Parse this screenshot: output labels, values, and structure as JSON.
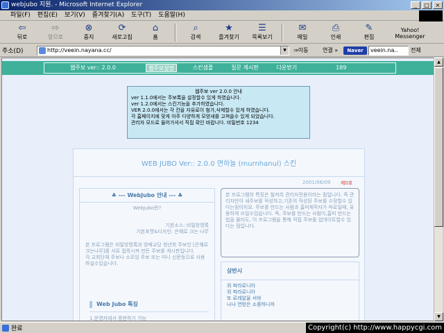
{
  "window": {
    "title": "webjubo 지원. - Microsoft Internet Explorer",
    "buttons": [
      "_",
      "□",
      "×"
    ]
  },
  "menu": [
    "파일(F)",
    "편집(E)",
    "보기(V)",
    "즐겨찾기(A)",
    "도구(T)",
    "도움말(H)"
  ],
  "toolbar": {
    "back": "뒤로",
    "forward": "앞으로",
    "stop": "중지",
    "refresh": "새로고침",
    "home": "홈",
    "search": "검색",
    "favorites": "즐겨찾기",
    "history": "목록보기",
    "mail": "메일",
    "print": "인쇄",
    "edit": "편집",
    "yahoo": "Yahoo! Messenger"
  },
  "address": {
    "label": "주소(D)",
    "url": "http://veein.nayana.cc/",
    "go": "⇒이동",
    "links": "연결 »",
    "naver": "Naver",
    "search_value": "veein.na..",
    "search_all": "전체"
  },
  "nav": {
    "items": [
      "웹주보 ver:: 2.0.0",
      "웹주보설명",
      "스킨샘플",
      "질문 게시판",
      "다운받기",
      "189"
    ]
  },
  "info": {
    "heading": "웹주보 ver 2.0.0 안내",
    "lines": [
      "ver 1.1.0에서는 주보록을 설정할수 있게 하였습니다.",
      "ver 1.2.0에서는 스킨기능을 추가하였습니다.",
      "VER 2.0.0에서는 각 칸을 자유로이 첨가,삭제할수 있게 하였습니다.",
      "각 홈페이지에 맞게 아주 다양하게 모양새를 고쳐쓸수 있게 되었습니다.",
      "관리자 모드로 들어가셔서 직접 확인 바랍니다. 비밀번호 1234"
    ]
  },
  "card": {
    "title": "WEB JUBO Ver:: 2.0.0 면하늘 (murnhanul) 스킨",
    "date": "2001/06/09",
    "count": "제0호",
    "left_heading": "♣ --- WebJubo 안내 --- ♣",
    "left_lines": {
      "q": "WebJubo란?",
      "credit1": "기본소스: 비밀방명록",
      "credit2": "기본포멧&디자인: 은혜로 크는 나무",
      "p1": "본 프로그램은 비밀방명록과 방배교당 청년회 주보인 [은혜로 크는나무]를 서로 접목시켜 만든 주보를 게시판입니다.",
      "p2": "각 교회단체 주보나 소모임 주보 또는 미니 신문등으로 사용하실수있습니다."
    },
    "left_sub_heading": "Web Jubo 특징",
    "left_sub_text": "1.운영자에서 증판하기 가능",
    "right_text": "본 프로그램의 특징은 철저히 관리자전용이라는 점입니다. 즉 관리자만이 새주보를 작성하고,기존의 작성된 주보를 수정할수 있다는점이지요. 주보를 만드는 사람과 홈피제작자가 따로일때, 유용하게 쓰일수있습니다. 즉, 주보를 만드는 사람이,홈피 만드는 법을 몰라도, 이 프로그램을 통해 직접 주보를 업데이트할수 있다는 점입니다.",
    "right_heading": "상반시",
    "right_lines": [
      "외 파라로니아",
      "외 파라로니아",
      "또 로레알울 서바",
      "나나 연방은 소중하니까"
    ]
  },
  "status": {
    "text": "완료",
    "copyright": "Copyright(c) http://www.happycgi.com"
  },
  "colors": {
    "nav_green": "#3fb19a",
    "info_bg": "#c8e8f4",
    "card_bg": "#f4f8fd",
    "title_blue": "#6aa8d8",
    "count_red": "#d04040"
  }
}
